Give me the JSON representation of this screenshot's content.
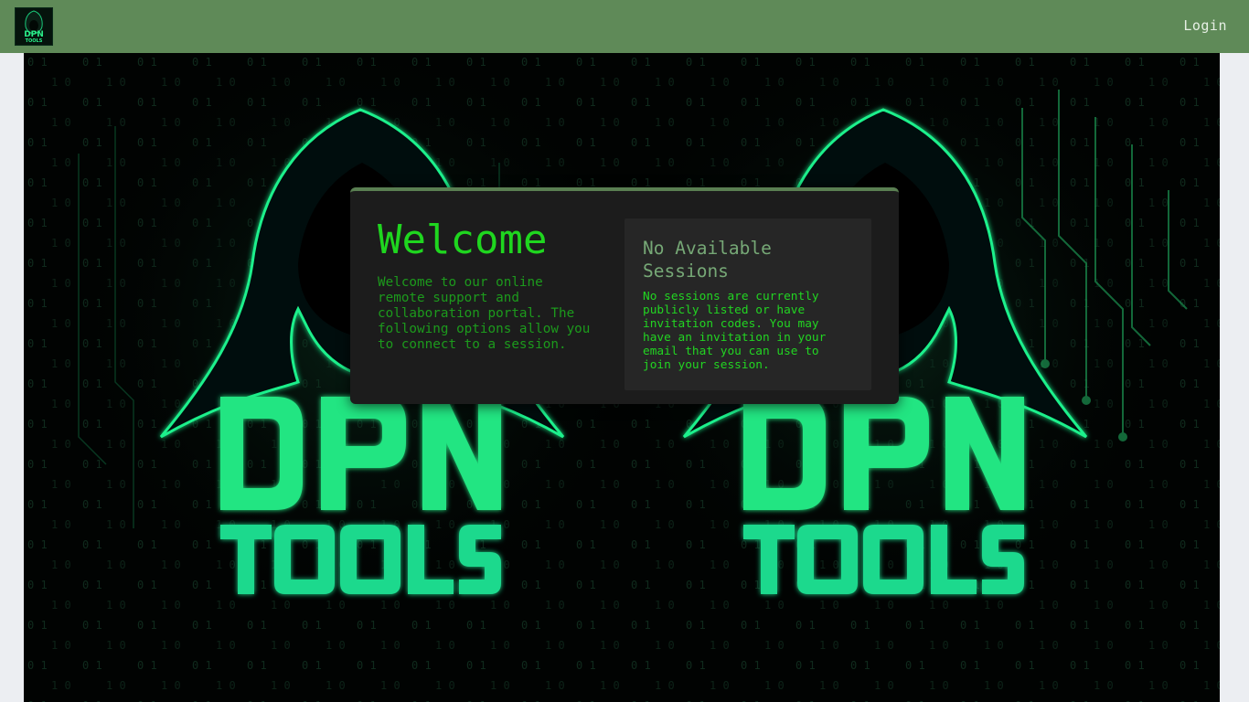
{
  "header": {
    "logo": {
      "top": "DPN",
      "bottom": "TOOLS",
      "icon": "hooded-hacker-logo"
    },
    "login_label": "Login"
  },
  "hero": {
    "logo_top": "DPN",
    "logo_bottom": "TOOLS",
    "icon": "hooded-hacker-artwork",
    "accent_color": "#19f08c"
  },
  "welcome": {
    "title": "Welcome",
    "text": "Welcome to our online remote support and collaboration portal. The following options allow you to connect to a session."
  },
  "sessions": {
    "title": "No Available Sessions",
    "text": "No sessions are currently publicly listed or have invitation codes. You may have an invitation in your email that you can use to join your session."
  },
  "colors": {
    "header_bg": "#5f8a58",
    "card_bg": "#1c1c1c",
    "accent_green": "#1fd61f"
  }
}
